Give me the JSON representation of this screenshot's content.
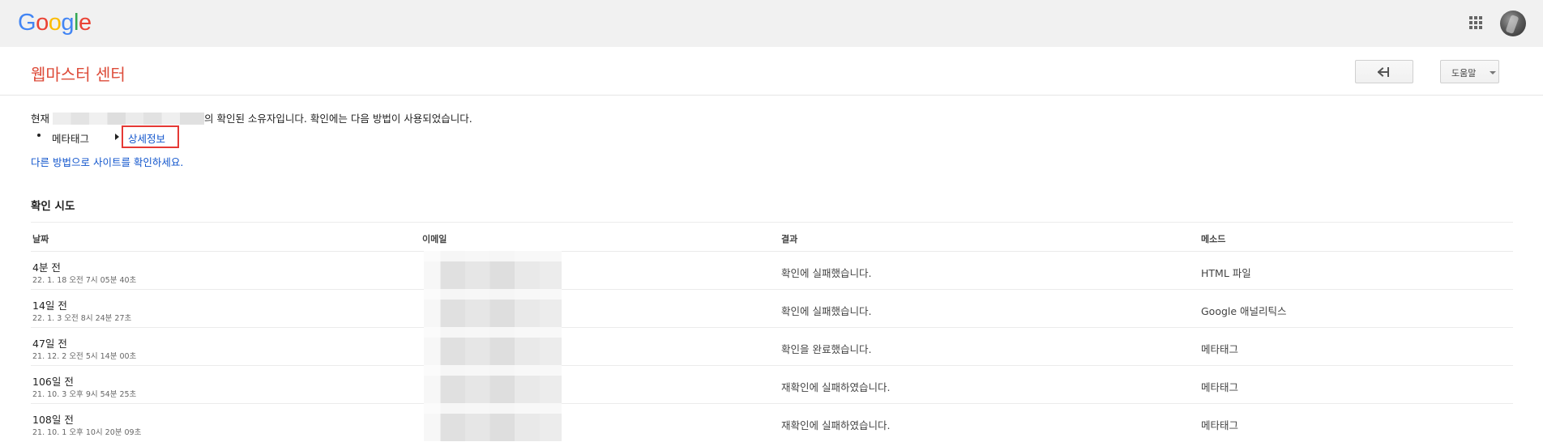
{
  "topbar": {
    "logo_letters": [
      "G",
      "o",
      "o",
      "g",
      "l",
      "e"
    ],
    "apps_icon": "apps-grid-icon",
    "avatar": "user-avatar"
  },
  "header": {
    "title": "웹마스터 센터",
    "back_icon": "back-arrow-icon",
    "help_label": "도움말"
  },
  "ownership": {
    "prefix": "현재 ",
    "suffix": "의 확인된 소유자입니다. 확인에는 다음 방법이 사용되었습니다.",
    "method": "메타태그",
    "details_link": "상세정보",
    "other_method_link": "다른 방법으로 사이트를 확인하세요."
  },
  "attempts": {
    "section_title": "확인 시도",
    "columns": {
      "date": "날짜",
      "email": "이메일",
      "result": "결과",
      "method": "메소드"
    },
    "rows": [
      {
        "relative": "4분 전",
        "absolute": "22. 1. 18 오전 7시 05분 40초",
        "result": "확인에 실패했습니다.",
        "method": "HTML 파일"
      },
      {
        "relative": "14일 전",
        "absolute": "22. 1. 3 오전 8시 24분 27초",
        "result": "확인에 실패했습니다.",
        "method": "Google 애널리틱스"
      },
      {
        "relative": "47일 전",
        "absolute": "21. 12. 2 오전 5시 14분 00초",
        "result": "확인을 완료했습니다.",
        "method": "메타태그"
      },
      {
        "relative": "106일 전",
        "absolute": "21. 10. 3 오후 9시 54분 25초",
        "result": "재확인에 실패하였습니다.",
        "method": "메타태그"
      },
      {
        "relative": "108일 전",
        "absolute": "21. 10. 1 오후 10시 20분 09초",
        "result": "재확인에 실패하였습니다.",
        "method": "메타태그"
      }
    ]
  },
  "colors": {
    "title_red": "#dd4b39",
    "link_blue": "#1155cc",
    "highlight_red": "#e53935",
    "topbar_bg": "#f1f1f1"
  }
}
